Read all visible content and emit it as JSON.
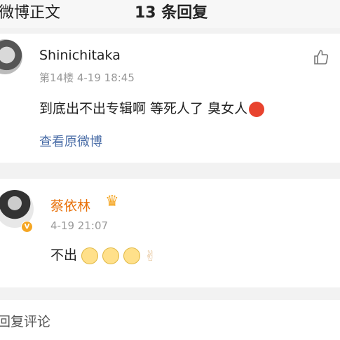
{
  "header": {
    "back_text": "微博正文",
    "title": "13 条回复"
  },
  "comments": [
    {
      "username": "Shinichitaka",
      "meta": "第14楼  4-19  18:45",
      "content": "到底出不出专辑啊  等死人了  臭女人",
      "link": "查看原微博",
      "emoji": "angry-face"
    },
    {
      "username": "蔡依林",
      "meta": "4-19  21:07",
      "content": "不出",
      "emojis": [
        "eye-roll-face",
        "eye-roll-face",
        "eye-roll-face",
        "victory-hand"
      ]
    }
  ],
  "reply": {
    "placeholder": "回复评论"
  },
  "colors": {
    "link": "#4a6da7",
    "vip_name": "#e8710a",
    "meta": "#999999"
  }
}
